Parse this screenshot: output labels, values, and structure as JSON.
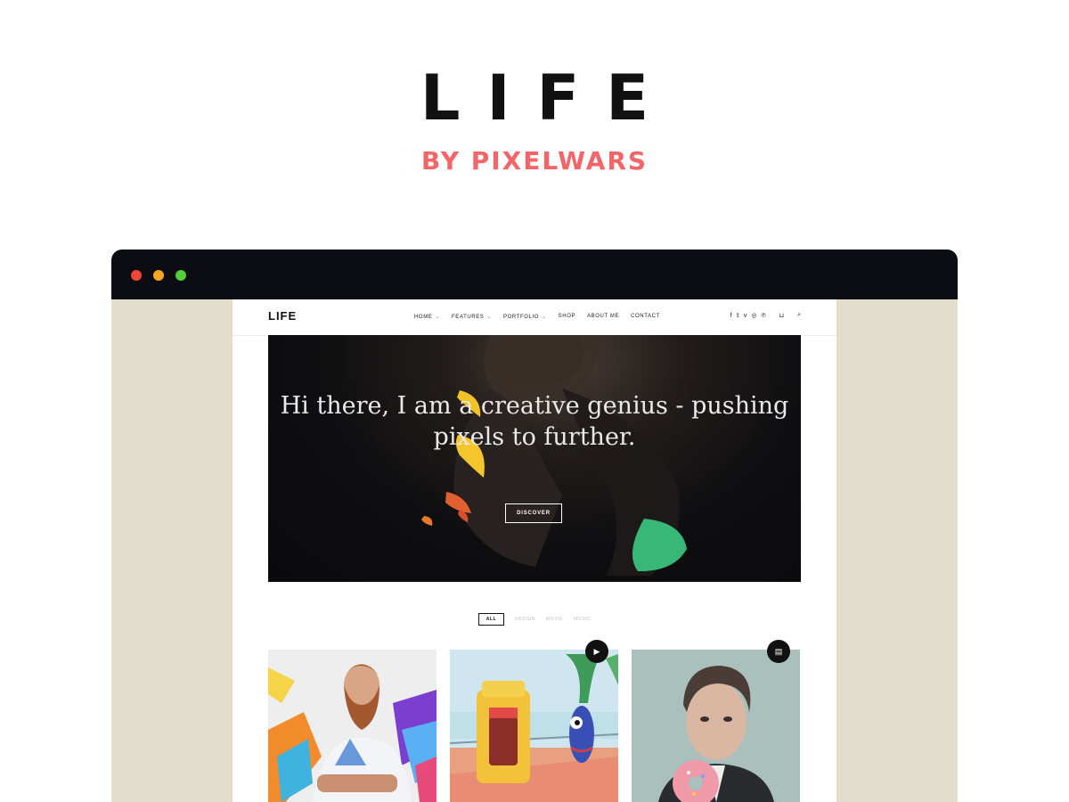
{
  "promo": {
    "title": "LIFE",
    "subtitle": "BY PIXELWARS"
  },
  "browser": {
    "controls": [
      "close",
      "minimize",
      "maximize"
    ]
  },
  "site": {
    "logo": "LIFE",
    "nav": [
      {
        "label": "HOME",
        "has_dropdown": true
      },
      {
        "label": "FEATURES",
        "has_dropdown": true
      },
      {
        "label": "PORTFOLIO",
        "has_dropdown": true
      },
      {
        "label": "SHOP",
        "has_dropdown": false
      },
      {
        "label": "ABOUT ME",
        "has_dropdown": false
      },
      {
        "label": "CONTACT",
        "has_dropdown": false
      }
    ],
    "chevron": "⌄",
    "header_icons": {
      "facebook": "f",
      "twitter": "𝕥",
      "vimeo": "v",
      "dribbble": "◎",
      "pinterest": "℗",
      "cart": "⊔",
      "search": "⌕"
    }
  },
  "hero": {
    "text": "Hi there, I am a creative genius - pushing pixels to further.",
    "button": "DISCOVER"
  },
  "filters": {
    "items": [
      "ALL",
      "DESIGN",
      "MOVIE",
      "MUSIC"
    ],
    "active": "ALL"
  },
  "portfolio": {
    "badges": {
      "video": "▶",
      "gallery": "▤"
    }
  },
  "colors": {
    "accent": "#f2666a",
    "browser_bar": "#0b0d12",
    "page_background": "#e1dfcb"
  }
}
